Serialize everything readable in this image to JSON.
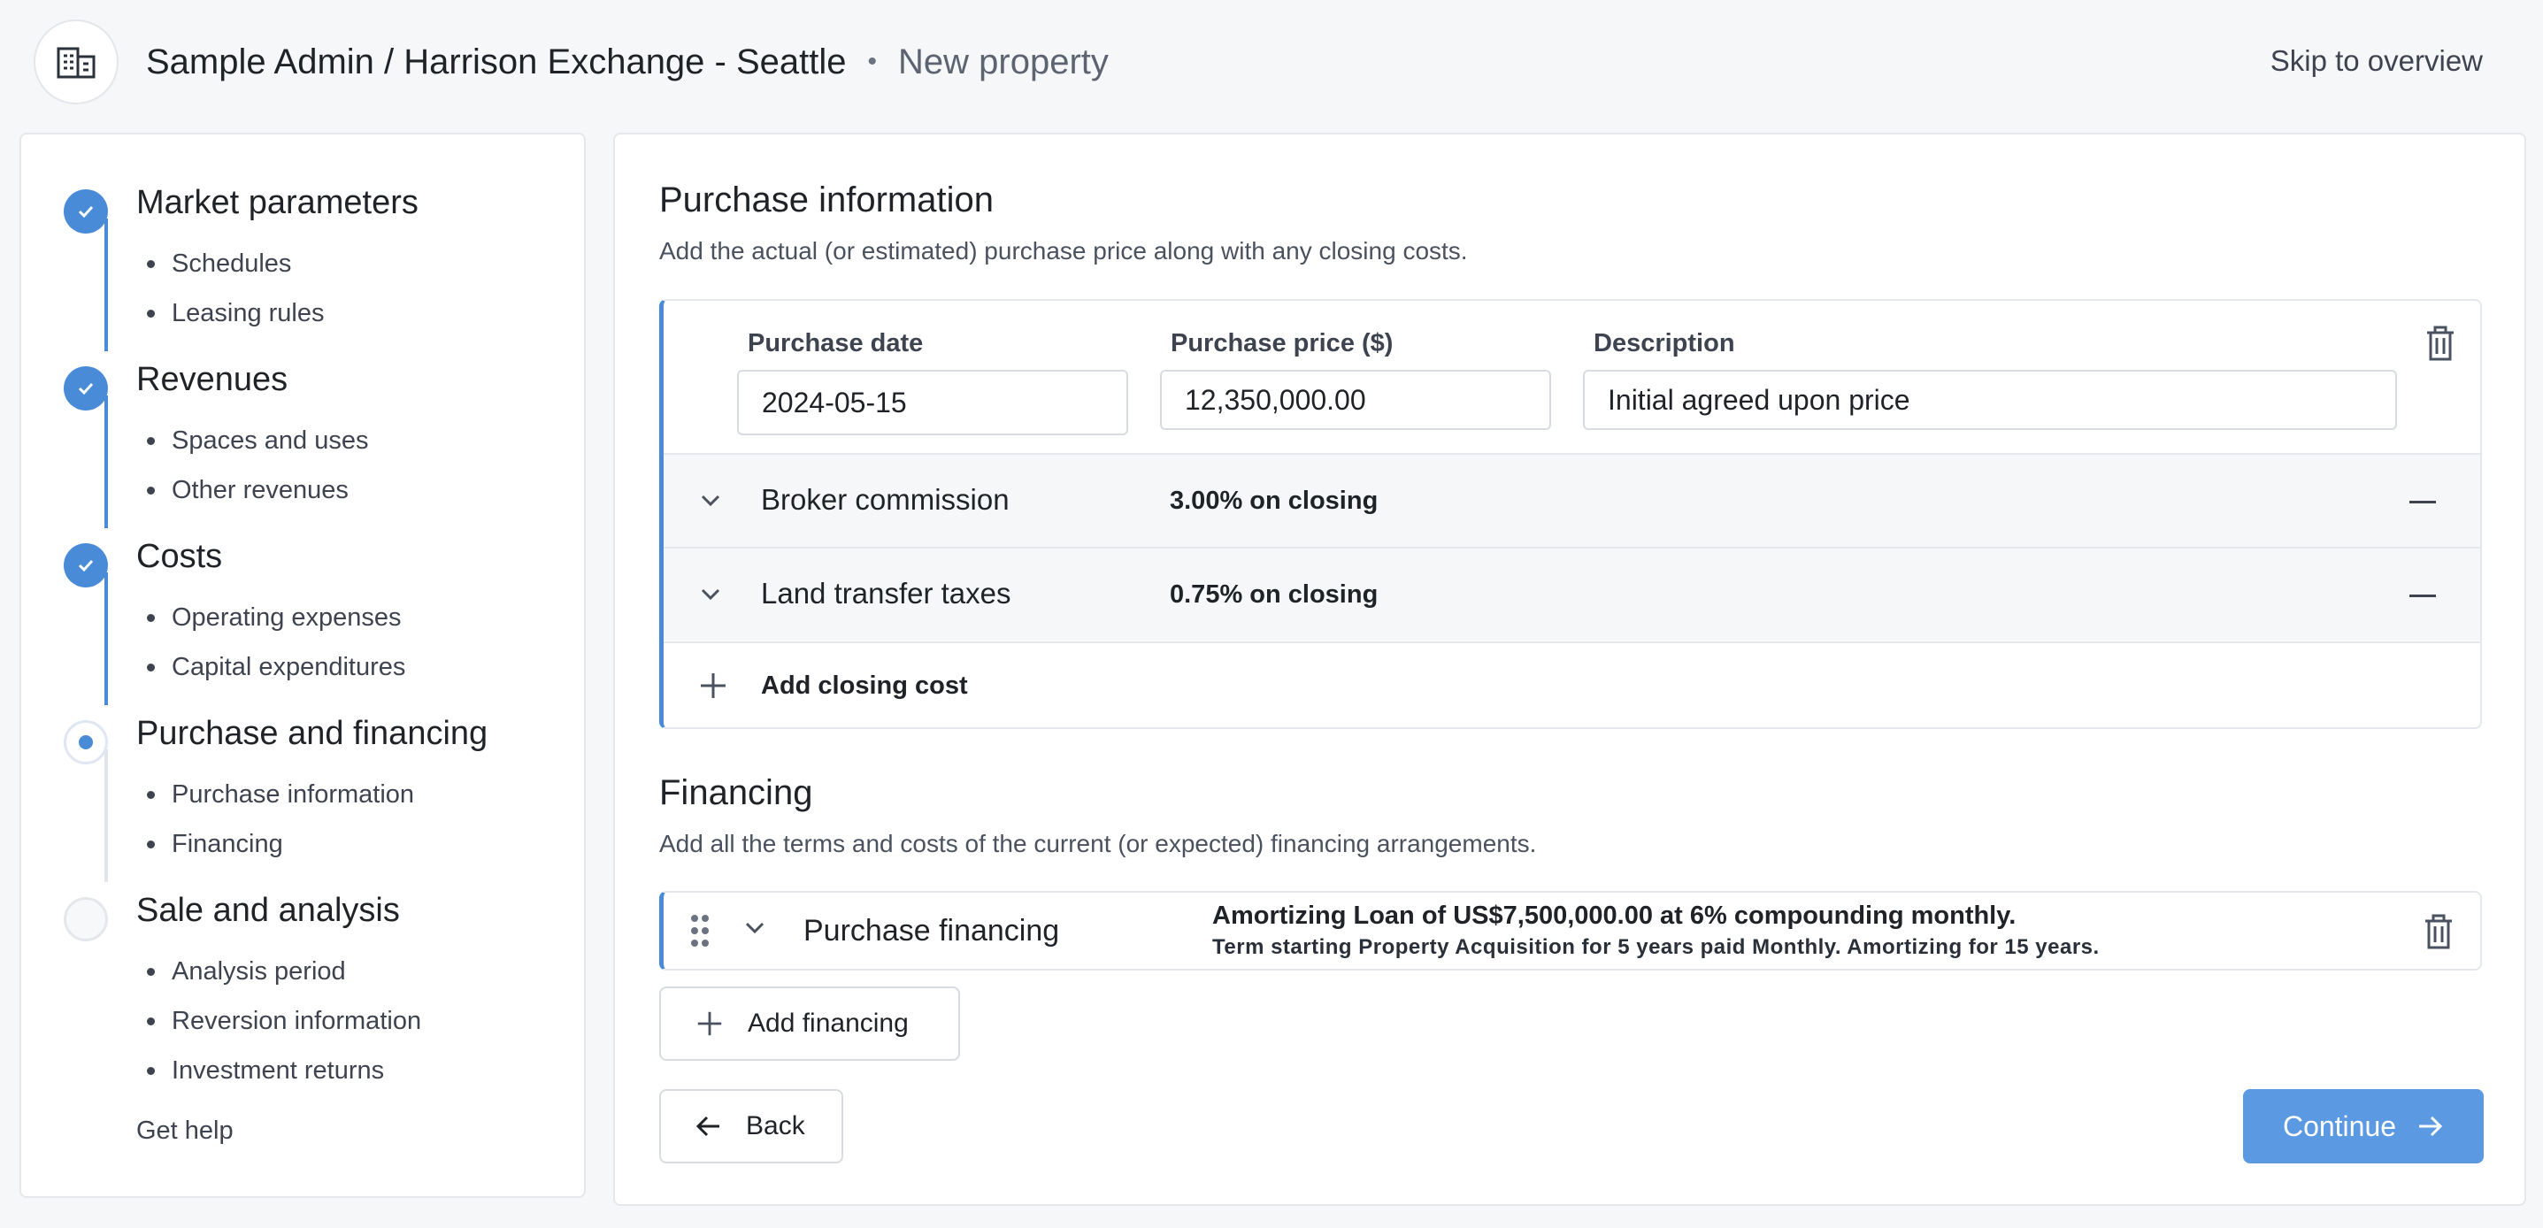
{
  "header": {
    "breadcrumb_path": "Sample Admin / Harrison Exchange - Seattle",
    "separator": "•",
    "page": "New property",
    "skip_link": "Skip to overview",
    "logo_icon": "building-icon"
  },
  "sidebar": {
    "steps": [
      {
        "title": "Market parameters",
        "status": "done",
        "items": [
          "Schedules",
          "Leasing rules"
        ]
      },
      {
        "title": "Revenues",
        "status": "done",
        "items": [
          "Spaces and uses",
          "Other revenues"
        ]
      },
      {
        "title": "Costs",
        "status": "done",
        "items": [
          "Operating expenses",
          "Capital expenditures"
        ]
      },
      {
        "title": "Purchase and financing",
        "status": "current",
        "items": [
          "Purchase information",
          "Financing"
        ]
      },
      {
        "title": "Sale and analysis",
        "status": "todo",
        "items": [
          "Analysis period",
          "Reversion information",
          "Investment returns"
        ]
      }
    ],
    "help": "Get help"
  },
  "purchase": {
    "title": "Purchase information",
    "description": "Add the actual (or estimated) purchase price along with any closing costs.",
    "date_label": "Purchase date",
    "date_value": "2024-05-15",
    "price_label": "Purchase price ($)",
    "price_value": "12,350,000.00",
    "desc_label": "Description",
    "desc_value": "Initial agreed upon price",
    "closing_costs": [
      {
        "name": "Broker commission",
        "value": "3.00% on closing"
      },
      {
        "name": "Land transfer taxes",
        "value": "0.75% on closing"
      }
    ],
    "add_closing": "Add closing cost"
  },
  "financing": {
    "title": "Financing",
    "description": "Add all the terms and costs of the current (or expected) financing arrangements.",
    "items": [
      {
        "name": "Purchase financing",
        "summary": "Amortizing Loan of US$7,500,000.00 at 6% compounding monthly.",
        "detail": "Term starting Property Acquisition for 5 years paid Monthly. Amortizing for 15 years."
      }
    ],
    "add_financing": "Add financing"
  },
  "footer": {
    "back": "Back",
    "continue": "Continue"
  },
  "colors": {
    "accent": "#4a8bd8",
    "primary_button": "#5b9ae2",
    "background": "#f6f7f9"
  }
}
